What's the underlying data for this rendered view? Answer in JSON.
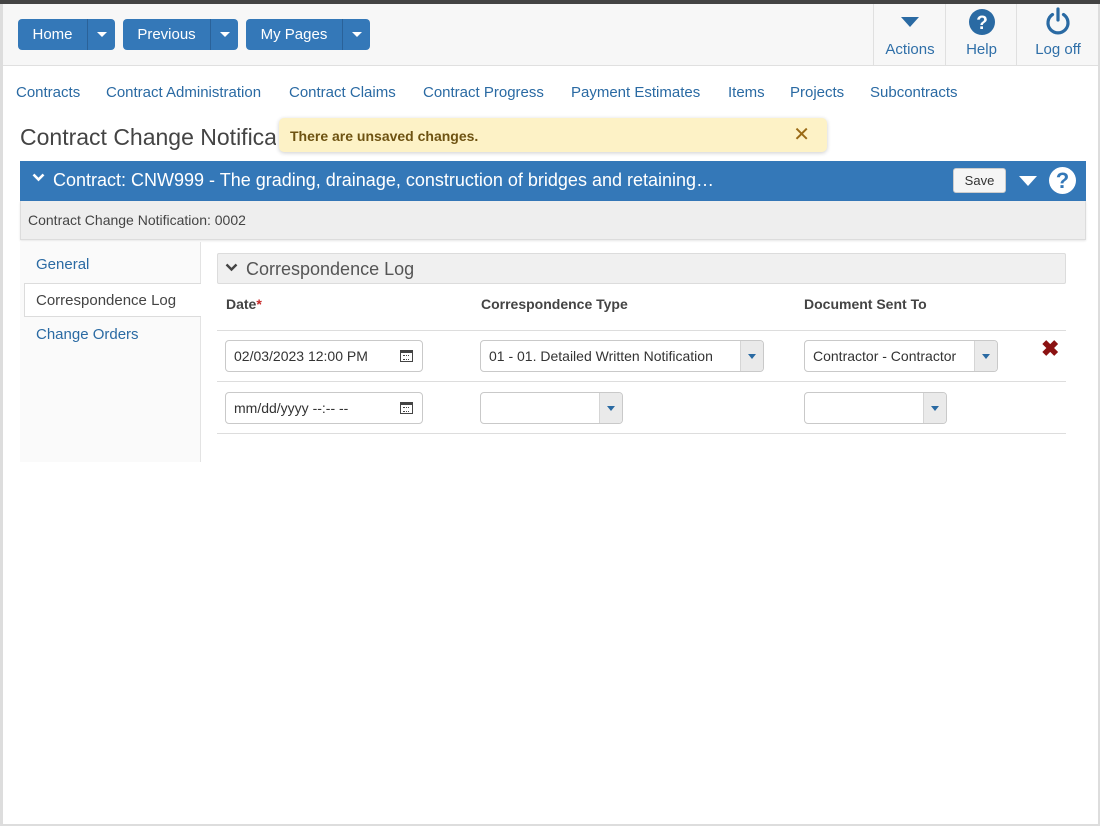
{
  "header": {
    "buttons": [
      {
        "label": "Home"
      },
      {
        "label": "Previous"
      },
      {
        "label": "My Pages"
      }
    ],
    "actions": {
      "label": "Actions",
      "icon": "caret-down-icon"
    },
    "help": {
      "label": "Help",
      "icon": "question-circle-icon"
    },
    "logoff": {
      "label": "Log off",
      "icon": "power-icon"
    }
  },
  "nav": [
    "Contracts",
    "Contract Administration",
    "Contract Claims",
    "Contract Progress",
    "Payment Estimates",
    "Items",
    "Projects",
    "Subcontracts"
  ],
  "page": {
    "title": "Contract Change Notification",
    "toast": "There are unsaved changes."
  },
  "contract_bar": {
    "title": "Contract: CNW999 - The grading, drainage, construction of bridges and retaining…",
    "save_label": "Save"
  },
  "sub_header": "Contract Change Notification: 0002",
  "left_tabs": [
    "General",
    "Correspondence Log",
    "Change Orders"
  ],
  "active_tab": "Correspondence Log",
  "section": {
    "title": "Correspondence Log",
    "columns": {
      "date": "Date",
      "required_mark": "*",
      "type": "Correspondence Type",
      "sent_to": "Document Sent To"
    },
    "rows": [
      {
        "date": "02/03/2023 12:00  PM",
        "type": "01 - 01. Detailed Written Notification",
        "sent_to": "Contractor - Contractor"
      },
      {
        "date": "mm/dd/yyyy --:-- --",
        "type": "",
        "sent_to": ""
      }
    ]
  },
  "colors": {
    "primary": "#3478b8",
    "link": "#2a6aa3",
    "toast_bg": "#fdf2c6",
    "delete": "#8b1212"
  }
}
